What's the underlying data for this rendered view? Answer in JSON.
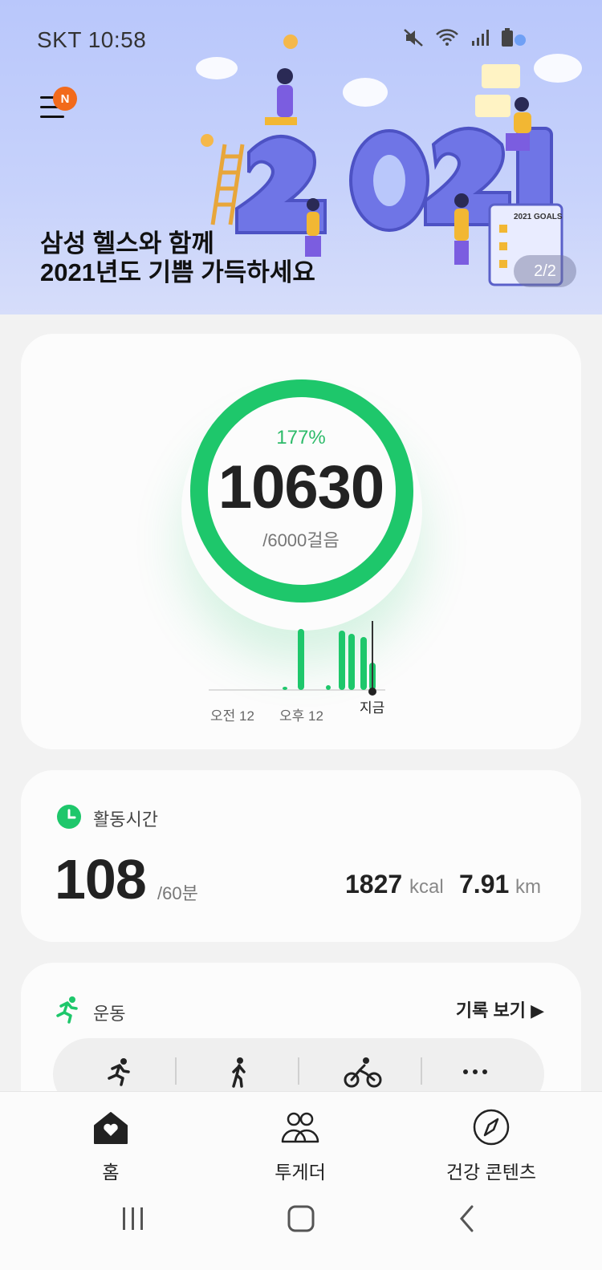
{
  "status_bar": {
    "carrier_time": "SKT 10:58"
  },
  "banner": {
    "badge": "N",
    "line1": "삼성 헬스와 함께",
    "line2": "2021년도 기쁨 가득하세요",
    "pager": "2/2",
    "art_text": "2021",
    "art_goals": "2021 GOALS"
  },
  "steps": {
    "percent": "177%",
    "count": "10630",
    "goal": "/6000걸음",
    "axis_am": "오전 12",
    "axis_pm": "오후 12",
    "now": "지금",
    "progress": 1.0,
    "color": "#1ec76b"
  },
  "activity": {
    "title": "활동시간",
    "minutes": "108",
    "goal": "/60분",
    "kcal_value": "1827",
    "kcal_unit": "kcal",
    "km_value": "7.91",
    "km_unit": "km"
  },
  "exercise": {
    "title": "운동",
    "history_label": "기록 보기 ▶",
    "items": [
      "running-icon",
      "walking-icon",
      "cycling-icon",
      "more-icon"
    ]
  },
  "nav": {
    "home": "홈",
    "together": "투게더",
    "content": "건강 콘텐츠"
  }
}
